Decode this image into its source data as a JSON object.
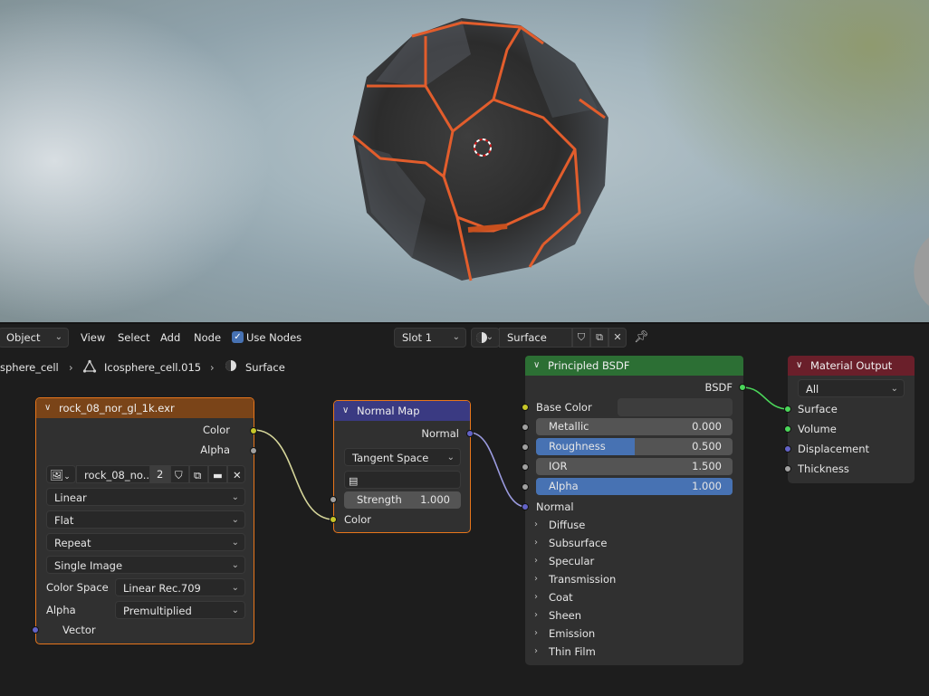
{
  "header": {
    "mode": "Object",
    "view": "View",
    "select": "Select",
    "add": "Add",
    "node": "Node",
    "use_nodes": "Use Nodes",
    "slot": "Slot 1",
    "material": "Surface"
  },
  "breadcrumb": {
    "object": "sphere_cell",
    "mesh": "Icosphere_cell.015",
    "material": "Surface"
  },
  "image_node": {
    "title": "rock_08_nor_gl_1k.exr",
    "out_color": "Color",
    "out_alpha": "Alpha",
    "image_name": "rock_08_no...",
    "users": "2",
    "interpolation": "Linear",
    "projection": "Flat",
    "extension": "Repeat",
    "source": "Single Image",
    "color_space_label": "Color Space",
    "color_space": "Linear Rec.709",
    "alpha_label": "Alpha",
    "alpha_mode": "Premultiplied",
    "in_vector": "Vector"
  },
  "normal_node": {
    "title": "Normal Map",
    "out_normal": "Normal",
    "space": "Tangent Space",
    "strength_label": "Strength",
    "strength": "1.000",
    "in_color": "Color"
  },
  "bsdf_node": {
    "title": "Principled BSDF",
    "out": "BSDF",
    "base_color": "Base Color",
    "metallic_label": "Metallic",
    "metallic": "0.000",
    "roughness_label": "Roughness",
    "roughness": "0.500",
    "roughness_fraction": 0.5,
    "ior_label": "IOR",
    "ior": "1.500",
    "alpha_label": "Alpha",
    "alpha": "1.000",
    "alpha_fraction": 1.0,
    "normal": "Normal",
    "panels": [
      "Diffuse",
      "Subsurface",
      "Specular",
      "Transmission",
      "Coat",
      "Sheen",
      "Emission",
      "Thin Film"
    ]
  },
  "output_node": {
    "title": "Material Output",
    "target": "All",
    "surface": "Surface",
    "volume": "Volume",
    "displacement": "Displacement",
    "thickness": "Thickness"
  },
  "colors": {
    "image_header": "#7a4418",
    "normal_header": "#3a3a82",
    "bsdf_header": "#2c6f34",
    "output_header": "#6a1f2a",
    "selection": "#e8761b",
    "accent": "#4772b3"
  }
}
